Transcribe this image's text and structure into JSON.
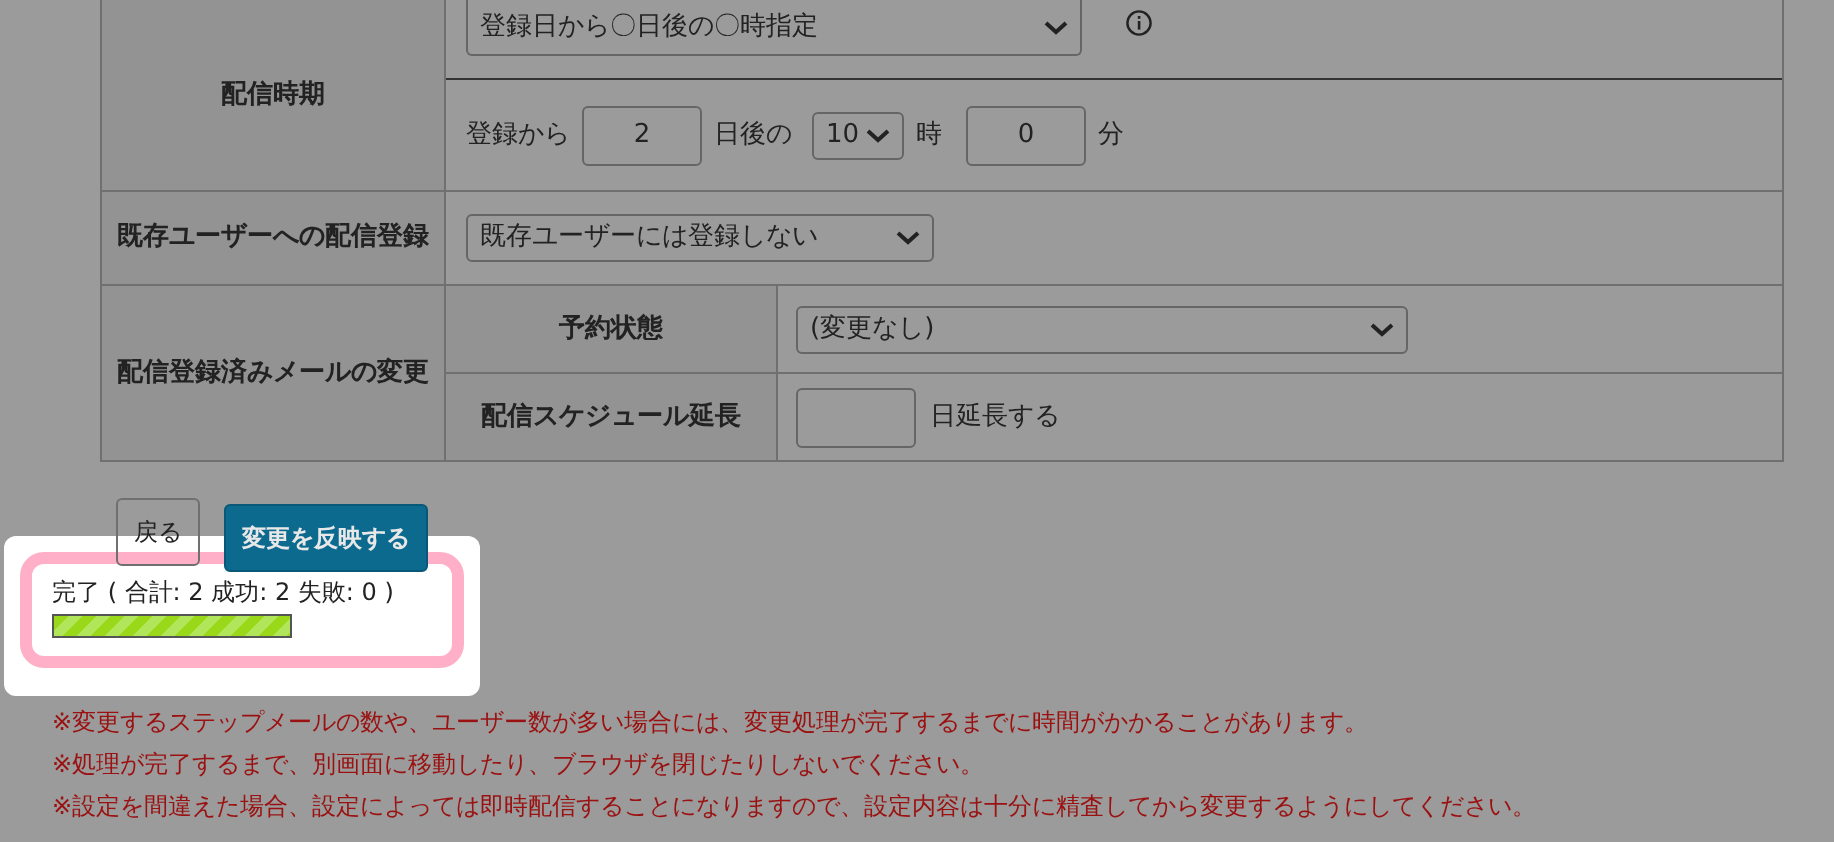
{
  "delivery_timing": {
    "label": "配信時期",
    "mode_select": "登録日から〇日後の〇時指定",
    "day_prefix": "登録から",
    "days": "2",
    "days_suffix": "日後の",
    "hour": "10",
    "hour_suffix": "時",
    "minute": "0",
    "minute_suffix": "分"
  },
  "existing_users": {
    "label": "既存ユーザーへの配信登録",
    "select": "既存ユーザーには登録しない"
  },
  "registered_mail_change": {
    "label": "配信登録済みメールの変更",
    "rows": [
      {
        "label": "予約状態",
        "kind": "select",
        "value": "(変更なし)"
      },
      {
        "label": "配信スケジュール延長",
        "kind": "input",
        "suffix": "日延長する"
      }
    ]
  },
  "buttons": [
    {
      "label": "戻る",
      "kind": "secondary"
    },
    {
      "label": "変更を反映する",
      "kind": "primary"
    }
  ],
  "dialog": {
    "status": "完了 ( 合計: 2 成功: 2 失敗: 0 )",
    "progress": {
      "level": 1
    }
  },
  "notes": [
    "※変更するステップメールの数や、ユーザー数が多い場合には、変更処理が完了するまでに時間がかかることがあります。",
    "※処理が完了するまで、別画面に移動したり、ブラウザを閉じたりしないでください。",
    "※設定を間違えた場合、設定によっては即時配信することになりますので、設定内容は十分に精査してから変更するようにしてください。"
  ]
}
